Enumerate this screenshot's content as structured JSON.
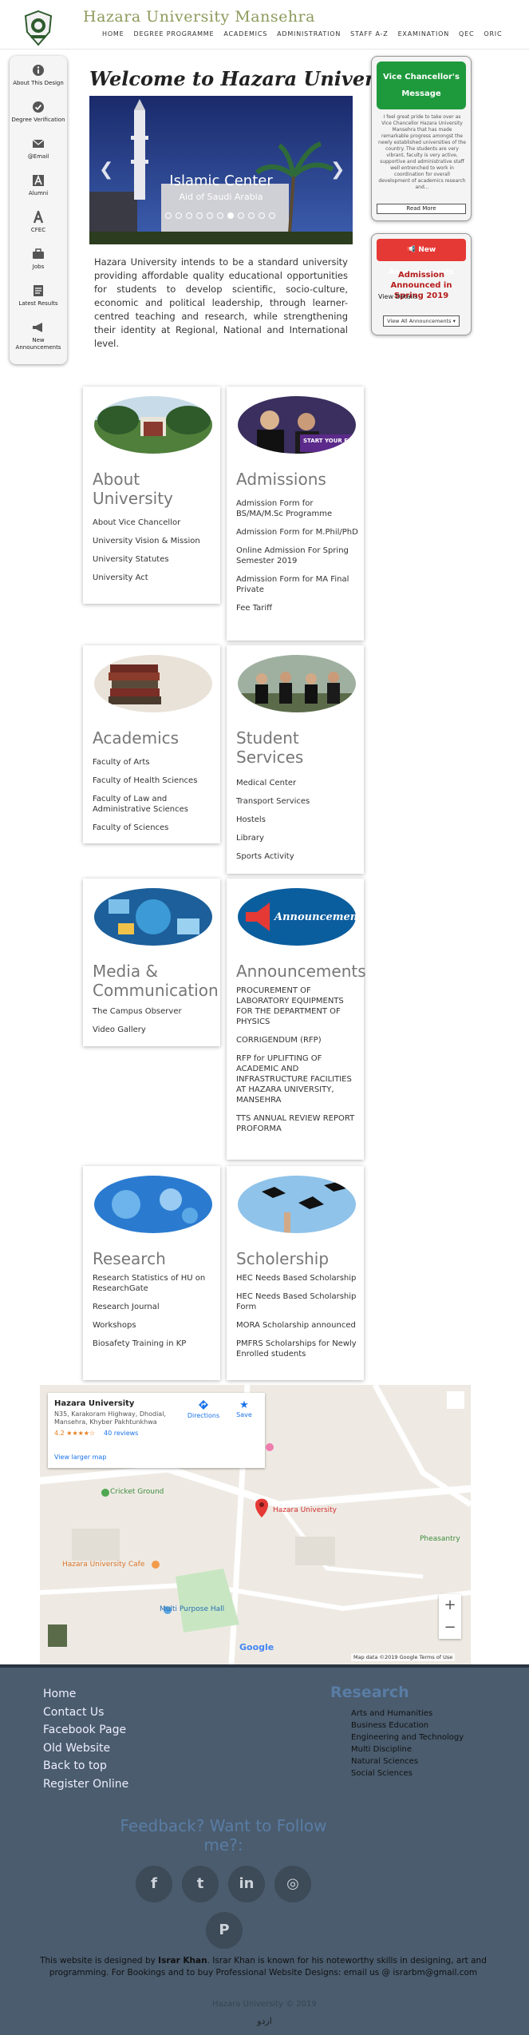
{
  "header": {
    "title": "Hazara University Mansehra",
    "nav": [
      "HOME",
      "DEGREE PROGRAMME",
      "ACADEMICS",
      "ADMINISTRATION",
      "STAFF A-Z",
      "EXAMINATION",
      "QEC",
      "ORIC"
    ]
  },
  "sidebar": {
    "items": [
      {
        "label": "About This Design",
        "icon": "info-icon"
      },
      {
        "label": "Degree Verification",
        "icon": "check-icon"
      },
      {
        "label": "@Email",
        "icon": "mail-icon"
      },
      {
        "label": "Alumni",
        "icon": "alumni-icon"
      },
      {
        "label": "CFEC",
        "icon": "cfec-icon"
      },
      {
        "label": "Jobs",
        "icon": "briefcase-icon"
      },
      {
        "label": "Latest Results",
        "icon": "results-icon"
      },
      {
        "label": "New Announcements",
        "icon": "megaphone-icon"
      }
    ]
  },
  "main": {
    "welcome": "Welcome to Hazara University",
    "slider": {
      "title": "Islamic Center",
      "subtitle": "Aid of Saudi Arabia",
      "dot_count": 11,
      "active_dot": 6
    },
    "intro": "Hazara University intends to be a standard university providing affordable quality educational opportunities for students to develop scientific, socio-culture, economic and political leadership, through learner-centred teaching and research, while strengthening their identity at Regional, National and International level."
  },
  "vc": {
    "button_line1": "Vice Chancellor's",
    "button_line2": "Message",
    "text": "I feel great pride to take over as Vice Chancellor Hazara University Mansehra that has made remarkable progress amongst the newly established universities of the country. The students are very vibrant, faculty is very active, supportive and administrative staff well entrenched to work in coordination for overall development of academics research and...",
    "read_more": "Read More"
  },
  "announcements_widget": {
    "header": "New Announcements",
    "title": "Admission Announced in Spring 2019",
    "details": "View Details",
    "view_all": "View All Announcements"
  },
  "cards": [
    {
      "title": "About University",
      "links": [
        "About Vice Chancellor",
        "University Vision & Mission",
        "University Statutes",
        "University Act"
      ]
    },
    {
      "title": "Admissions",
      "image_text": "START YOUR FUTURE NO",
      "links": [
        "Admission Form for BS/MA/M.Sc Programme",
        "Admission Form for M.Phil/PhD",
        "Online Admission For Spring Semester 2019",
        "Admission Form for MA Final Private",
        "Fee Tariff"
      ]
    },
    {
      "title": "Academics",
      "links": [
        "Faculty of Arts",
        "Faculty of Health Sciences",
        "Faculty of Law and Administrative Sciences",
        "Faculty of Sciences"
      ]
    },
    {
      "title": "Student Services",
      "links": [
        "Medical Center",
        "Transport Services",
        "Hostels",
        "Library",
        "Sports Activity"
      ]
    },
    {
      "title": "Media & Communication",
      "links": [
        "The Campus Observer",
        "Video Gallery"
      ]
    },
    {
      "title": "Announcements",
      "image_text": "Announcements!",
      "links": [
        "PROCUREMENT OF LABORATORY EQUIPMENTS FOR THE DEPARTMENT OF PHYSICS",
        "CORRIGENDUM (RFP)",
        "RFP for UPLIFTING OF ACADEMIC AND INFRASTRUCTURE FACILITIES AT HAZARA UNIVERSITY, MANSEHRA",
        "TTS ANNUAL REVIEW REPORT PROFORMA"
      ]
    },
    {
      "title": "Research",
      "links": [
        "Research Statistics of HU on ResearchGate",
        "Research Journal",
        "Workshops",
        "Biosafety Training in KP"
      ]
    },
    {
      "title": "Scholership",
      "links": [
        "HEC Needs Based Scholarship",
        "HEC Needs Based Scholarship Form",
        "MORA Scholarship announced",
        "PMFRS Scholarships for Newly Enrolled students"
      ]
    }
  ],
  "map": {
    "place_name": "Hazara University",
    "address": "N35, Karakoram Highway, Dhodial, Mansehra, Khyber Pakhtunkhwa",
    "rating": "4.2 ★★★★☆",
    "reviews": "40 reviews",
    "larger_map": "View larger map",
    "directions": "Directions",
    "save": "Save",
    "pin_label": "Hazara University",
    "labels": [
      "Cricket Ground",
      "Hazara University Cafe",
      "Multi Purpose Hall",
      "Pheasantry"
    ],
    "footer_text": "Map data ©2019 Google   Terms of Use",
    "google": "Google",
    "zoom_in": "+",
    "zoom_out": "−"
  },
  "footer": {
    "links": [
      "Home",
      "Contact Us",
      "Facebook Page",
      "Old Website",
      "Back to top",
      "Register Online"
    ],
    "research_title": "Research",
    "research_list": [
      "Arts and Humanities",
      "Business Education",
      "Engineering and Technology",
      "Multi Discipline",
      "Natural Sciences",
      "Social Sciences"
    ],
    "feedback": "Feedback? Want to Follow me?:",
    "social": [
      {
        "icon": "facebook-icon",
        "glyph": "f"
      },
      {
        "icon": "twitter-icon",
        "glyph": "t"
      },
      {
        "icon": "linkedin-icon",
        "glyph": "in"
      },
      {
        "icon": "instagram-icon",
        "glyph": "◎"
      },
      {
        "icon": "pinterest-icon",
        "glyph": "P"
      }
    ],
    "designer_pre": "This website is designed by ",
    "designer_name": "Israr Khan",
    "designer_post": ". Israr Khan is known for his noteworthy skills in designing, art and programming. For Bookings and to buy Professional Website Designs: email us @ israrbm@gmail.com",
    "copyright": "Hazara University © 2019",
    "urdu": "اردو"
  },
  "colors": {
    "accent_green": "#1e9a3c",
    "accent_red": "#e53935",
    "footer_bg": "#4a5c6e",
    "title_olive": "#8c9a5b"
  }
}
